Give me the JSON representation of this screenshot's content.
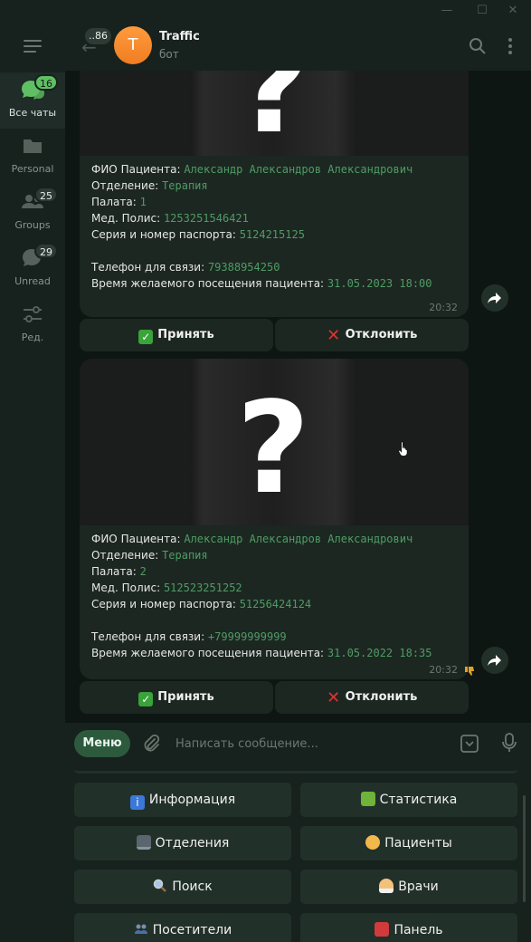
{
  "window": {
    "minimize_icon": "minimize-icon",
    "maximize_icon": "maximize-icon",
    "close_icon": "close-icon"
  },
  "sidebar": {
    "folders": [
      {
        "label": "Все чаты",
        "badge": "16",
        "icon": "chats-icon",
        "active": true
      },
      {
        "label": "Personal",
        "badge": "",
        "icon": "folder-icon"
      },
      {
        "label": "Groups",
        "badge": "25",
        "icon": "groups-icon"
      },
      {
        "label": "Unread",
        "badge": "29",
        "icon": "unread-icon"
      },
      {
        "label": "Ред.",
        "badge": "",
        "icon": "edit-folders-icon"
      }
    ]
  },
  "header": {
    "back_badge": "..86",
    "avatar_letter": "T",
    "title": "Traffic",
    "subtitle": "бот",
    "avatar_color": "#f38a2b"
  },
  "messages": [
    {
      "fields": [
        {
          "key": "ФИО Пациента: ",
          "value": "Александр Александров Александрович"
        },
        {
          "key": "Отделение: ",
          "value": "Терапия"
        },
        {
          "key": "Палата: ",
          "value": "1"
        },
        {
          "key": "Мед. Полис: ",
          "value": "1253251546421"
        },
        {
          "key": "Серия и номер паспорта: ",
          "value": "5124215125"
        },
        {
          "key": "Телефон для связи: ",
          "value": "79388954250"
        },
        {
          "key": "Время желаемого посещения пациента: ",
          "value": "31.05.2023 18:00"
        }
      ],
      "time": "20:32",
      "accept": "Принять",
      "reject": "Отклонить"
    },
    {
      "photo_text": "?",
      "fields": [
        {
          "key": "ФИО Пациента: ",
          "value": "Александр Александров Александрович"
        },
        {
          "key": "Отделение: ",
          "value": "Терапия"
        },
        {
          "key": "Палата: ",
          "value": "2"
        },
        {
          "key": "Мед. Полис: ",
          "value": "512523251252"
        },
        {
          "key": "Серия и номер паспорта: ",
          "value": "51256424124"
        },
        {
          "key": "Телефон для связи: ",
          "value": "+79999999999"
        },
        {
          "key": "Время желаемого посещения пациента: ",
          "value": "31.05.2022 18:35"
        }
      ],
      "time": "20:32",
      "accept": "Принять",
      "reject": "Отклонить"
    }
  ],
  "input": {
    "menu_label": "Меню",
    "placeholder": "Написать сообщение..."
  },
  "keyboard": {
    "buttons": [
      {
        "label": "Информация"
      },
      {
        "label": "Статистика"
      },
      {
        "label": "Отделения"
      },
      {
        "label": "Пациенты"
      },
      {
        "label": "Поиск"
      },
      {
        "label": "Врачи"
      },
      {
        "label": "Посетители"
      },
      {
        "label": "Панель"
      }
    ]
  },
  "colors": {
    "accent": "#5fbf63",
    "value_text": "#4f9c63",
    "bubble": "#1c2722",
    "background": "#0e1613"
  }
}
